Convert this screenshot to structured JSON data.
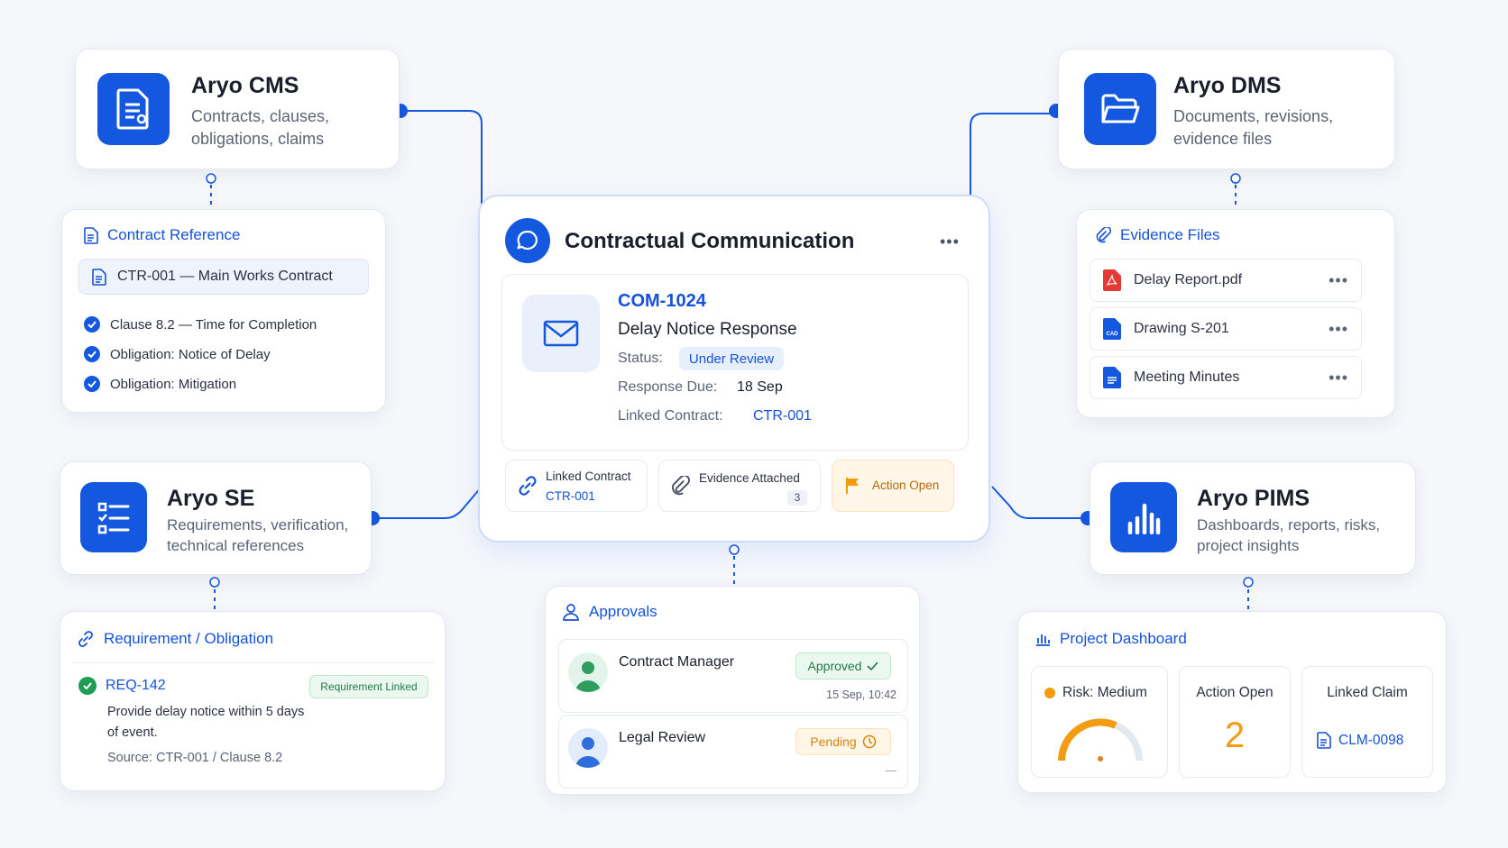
{
  "center": {
    "title": "Contractual Communication",
    "menu": "•••",
    "id": "COM-1024",
    "subject": "Delay Notice Response",
    "status_label": "Status:",
    "status_value": "Under Review",
    "due_label": "Response Due:",
    "due_value": "18 Sep",
    "linked_label": "Linked Contract:",
    "linked_value": "CTR-001",
    "chip_linked_label": "Linked Contract",
    "chip_linked_value": "CTR-001",
    "chip_evidence_label": "Evidence Attached",
    "chip_evidence_count": "3",
    "chip_action_label": "Action Open"
  },
  "cms": {
    "title": "Aryo CMS",
    "desc": "Contracts, clauses, obligations, claims",
    "ref_title": "Contract Reference",
    "ref_contract": "CTR-001 — Main Works Contract",
    "items": [
      "Clause 8.2 — Time for Completion",
      "Obligation: Notice of Delay",
      "Obligation: Mitigation"
    ]
  },
  "dms": {
    "title": "Aryo DMS",
    "desc": "Documents, revisions, evidence files",
    "files_title": "Evidence Files",
    "files": [
      {
        "name": "Delay Report.pdf",
        "menu": "•••",
        "icon": "pdf-file-icon"
      },
      {
        "name": "Drawing S-201",
        "menu": "•••",
        "icon": "cad-file-icon"
      },
      {
        "name": "Meeting Minutes",
        "menu": "•••",
        "icon": "document-file-icon"
      }
    ]
  },
  "se": {
    "title": "Aryo SE",
    "desc": "Requirements, verification, technical references",
    "req_title": "Requirement / Obligation",
    "req_id": "REQ-142",
    "req_badge": "Requirement Linked",
    "req_text": "Provide delay notice within 5 days of event.",
    "req_source": "Source: CTR-001 / Clause 8.2"
  },
  "pims": {
    "title": "Aryo PIMS",
    "desc": "Dashboards, reports, risks, project insights",
    "dash_title": "Project Dashboard",
    "risk_label": "Risk: Medium",
    "action_label": "Action Open",
    "action_value": "2",
    "claim_label": "Linked Claim",
    "claim_value": "CLM-0098"
  },
  "approvals": {
    "title": "Approvals",
    "rows": [
      {
        "name": "Contract Manager",
        "status": "Approved",
        "time": "15 Sep, 10:42"
      },
      {
        "name": "Legal Review",
        "status": "Pending",
        "time": "—"
      }
    ]
  },
  "colors": {
    "primary": "#1558e0",
    "link": "#1652d9",
    "success": "#1f9d55",
    "warning": "#f39c12",
    "background": "#f5f7fb"
  }
}
